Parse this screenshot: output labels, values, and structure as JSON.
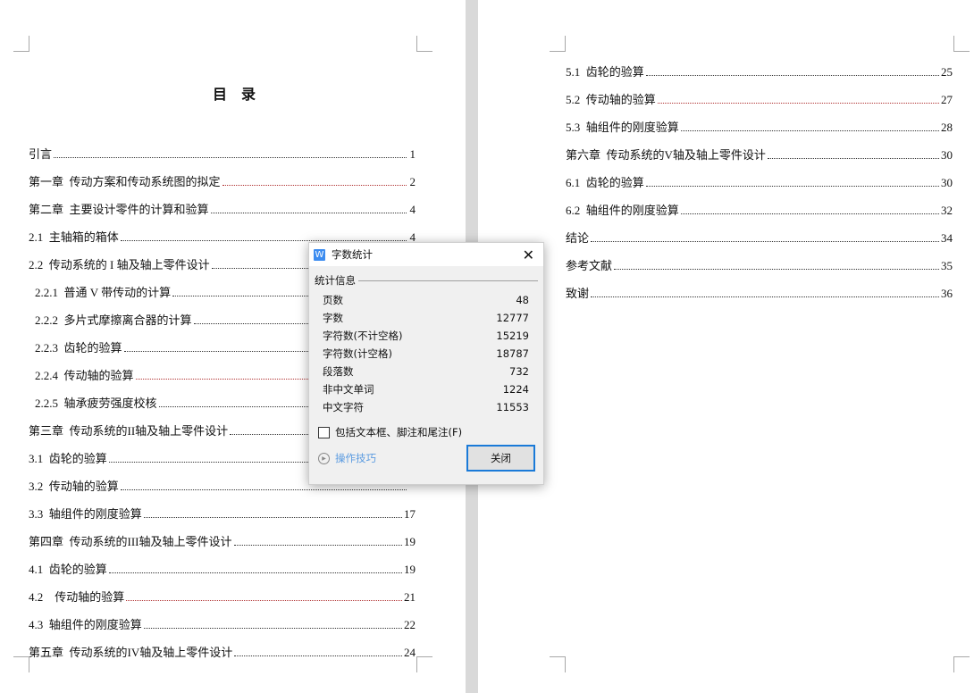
{
  "left_page": {
    "title": "目 录",
    "entries": [
      {
        "label": "引言",
        "page": "1",
        "red": false,
        "indent": false
      },
      {
        "label": "第一章  传动方案和传动系统图的拟定",
        "page": "2",
        "red": true,
        "indent": false
      },
      {
        "label": "第二章  主要设计零件的计算和验算",
        "page": "4",
        "red": false,
        "indent": false
      },
      {
        "label": "2.1  主轴箱的箱体",
        "page": "4",
        "red": false,
        "indent": false
      },
      {
        "label": "2.2  传动系统的 I 轴及轴上零件设计",
        "page": "",
        "red": false,
        "indent": false
      },
      {
        "label": "2.2.1  普通 V 带传动的计算",
        "page": "",
        "red": false,
        "indent": true
      },
      {
        "label": "2.2.2  多片式摩擦离合器的计算",
        "page": "",
        "red": false,
        "indent": true
      },
      {
        "label": "2.2.3  齿轮的验算",
        "page": "",
        "red": false,
        "indent": true
      },
      {
        "label": "2.2.4  传动轴的验算",
        "page": "",
        "red": true,
        "indent": true
      },
      {
        "label": "2.2.5  轴承疲劳强度校核",
        "page": "",
        "red": false,
        "indent": true
      },
      {
        "label": "第三章  传动系统的II轴及轴上零件设计",
        "page": "",
        "red": false,
        "indent": false
      },
      {
        "label": "3.1  齿轮的验算",
        "page": "",
        "red": false,
        "indent": false
      },
      {
        "label": "3.2  传动轴的验算",
        "page": "",
        "red": false,
        "indent": false
      },
      {
        "label": "3.3  轴组件的刚度验算",
        "page": "17",
        "red": false,
        "indent": false
      },
      {
        "label": "第四章  传动系统的III轴及轴上零件设计",
        "page": "19",
        "red": false,
        "indent": false
      },
      {
        "label": "4.1  齿轮的验算",
        "page": "19",
        "red": false,
        "indent": false
      },
      {
        "label": "4.2    传动轴的验算",
        "page": "21",
        "red": true,
        "indent": false
      },
      {
        "label": "4.3  轴组件的刚度验算",
        "page": "22",
        "red": false,
        "indent": false
      },
      {
        "label": "第五章  传动系统的IV轴及轴上零件设计",
        "page": "24",
        "red": false,
        "indent": false
      }
    ]
  },
  "right_page": {
    "entries": [
      {
        "label": "5.1  齿轮的验算",
        "page": "25",
        "red": false
      },
      {
        "label": "5.2  传动轴的验算",
        "page": "27",
        "red": true
      },
      {
        "label": "5.3  轴组件的刚度验算",
        "page": "28",
        "red": false
      },
      {
        "label": "第六章  传动系统的V轴及轴上零件设计",
        "page": "30",
        "red": false
      },
      {
        "label": "6.1  齿轮的验算",
        "page": "30",
        "red": false
      },
      {
        "label": "6.2  轴组件的刚度验算",
        "page": "32",
        "red": false
      },
      {
        "label": "结论",
        "page": "34",
        "red": false
      },
      {
        "label": "参考文献",
        "page": "35",
        "red": false
      },
      {
        "label": "致谢",
        "page": "36",
        "red": false
      }
    ]
  },
  "dialog": {
    "title": "字数统计",
    "app_icon": "W",
    "close_icon": "✕",
    "group_label": "统计信息",
    "stats": [
      {
        "label": "页数",
        "value": "48"
      },
      {
        "label": "字数",
        "value": "12777"
      },
      {
        "label": "字符数(不计空格)",
        "value": "15219"
      },
      {
        "label": "字符数(计空格)",
        "value": "18787"
      },
      {
        "label": "段落数",
        "value": "732"
      },
      {
        "label": "非中文单词",
        "value": "1224"
      },
      {
        "label": "中文字符",
        "value": "11553"
      }
    ],
    "checkbox_label": "包括文本框、脚注和尾注(F)",
    "checkbox_checked": false,
    "tips_label": "操作技巧",
    "close_button": "关闭",
    "accent_color": "#1a7ad8"
  }
}
